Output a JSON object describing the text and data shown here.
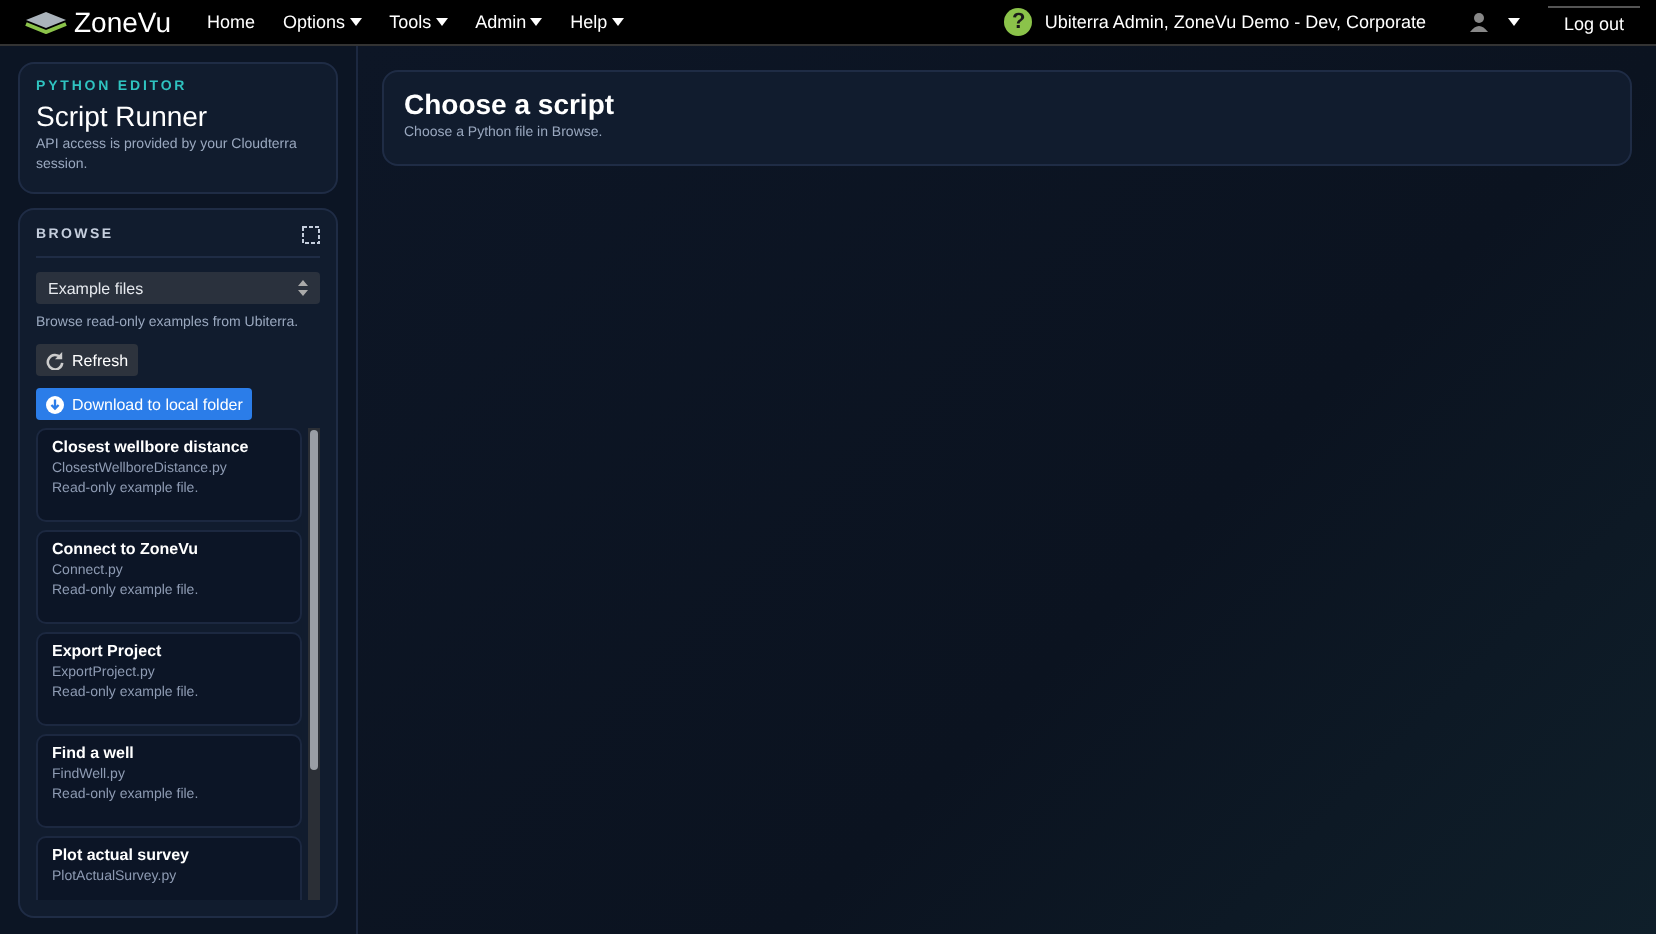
{
  "navbar": {
    "brand": "ZoneVu",
    "menus": [
      {
        "label": "Home",
        "dropdown": false
      },
      {
        "label": "Options",
        "dropdown": true
      },
      {
        "label": "Tools",
        "dropdown": true
      },
      {
        "label": "Admin",
        "dropdown": true
      },
      {
        "label": "Help",
        "dropdown": true
      }
    ],
    "help": "?",
    "user": "Ubiterra Admin, ZoneVu Demo - Dev, Corporate",
    "logout": "Log out"
  },
  "editor": {
    "eyebrow": "PYTHON EDITOR",
    "title": "Script Runner",
    "note": "API access is provided by your Cloudterra session."
  },
  "browse": {
    "title": "BROWSE",
    "source": "Example files",
    "hint": "Browse read-only examples from Ubiterra.",
    "refresh": "Refresh",
    "download": "Download to local folder",
    "files": [
      {
        "title": "Closest wellbore distance",
        "file": "ClosestWellboreDistance.py",
        "note": "Read-only example file."
      },
      {
        "title": "Connect to ZoneVu",
        "file": "Connect.py",
        "note": "Read-only example file."
      },
      {
        "title": "Export Project",
        "file": "ExportProject.py",
        "note": "Read-only example file."
      },
      {
        "title": "Find a well",
        "file": "FindWell.py",
        "note": "Read-only example file."
      },
      {
        "title": "Plot actual survey",
        "file": "PlotActualSurvey.py"
      }
    ]
  },
  "main": {
    "title": "Choose a script",
    "subtitle": "Choose a Python file in Browse."
  }
}
